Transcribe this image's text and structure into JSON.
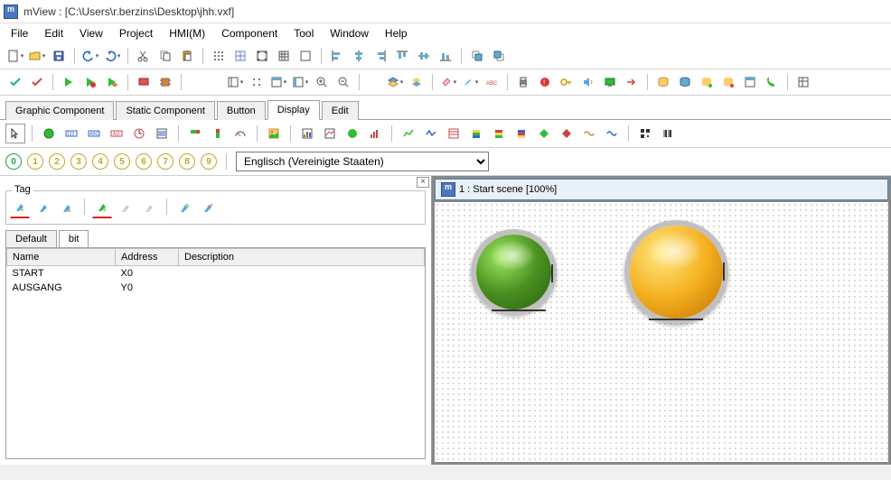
{
  "title": "mView : [C:\\Users\\r.berzins\\Desktop\\jhh.vxf]",
  "menu": [
    "File",
    "Edit",
    "View",
    "Project",
    "HMI(M)",
    "Component",
    "Tool",
    "Window",
    "Help"
  ],
  "component_tabs": [
    "Graphic Component",
    "Static Component",
    "Button",
    "Display",
    "Edit"
  ],
  "active_component_tab": "Display",
  "lang_numbers": [
    "0",
    "1",
    "2",
    "3",
    "4",
    "5",
    "6",
    "7",
    "8",
    "9"
  ],
  "lang_selected": "Englisch (Vereinigte Staaten)",
  "tag_panel": {
    "label": "Tag",
    "tabs": [
      "Default",
      "bit"
    ],
    "active_tab": "bit",
    "columns": [
      "Name",
      "Address",
      "Description"
    ],
    "rows": [
      {
        "name": "START",
        "address": "X0",
        "description": ""
      },
      {
        "name": "AUSGANG",
        "address": "Y0",
        "description": ""
      }
    ]
  },
  "scene": {
    "title": "1 : Start scene [100%]"
  },
  "colors": {
    "num_default": "#c0a820",
    "num_active": "#20a050"
  }
}
